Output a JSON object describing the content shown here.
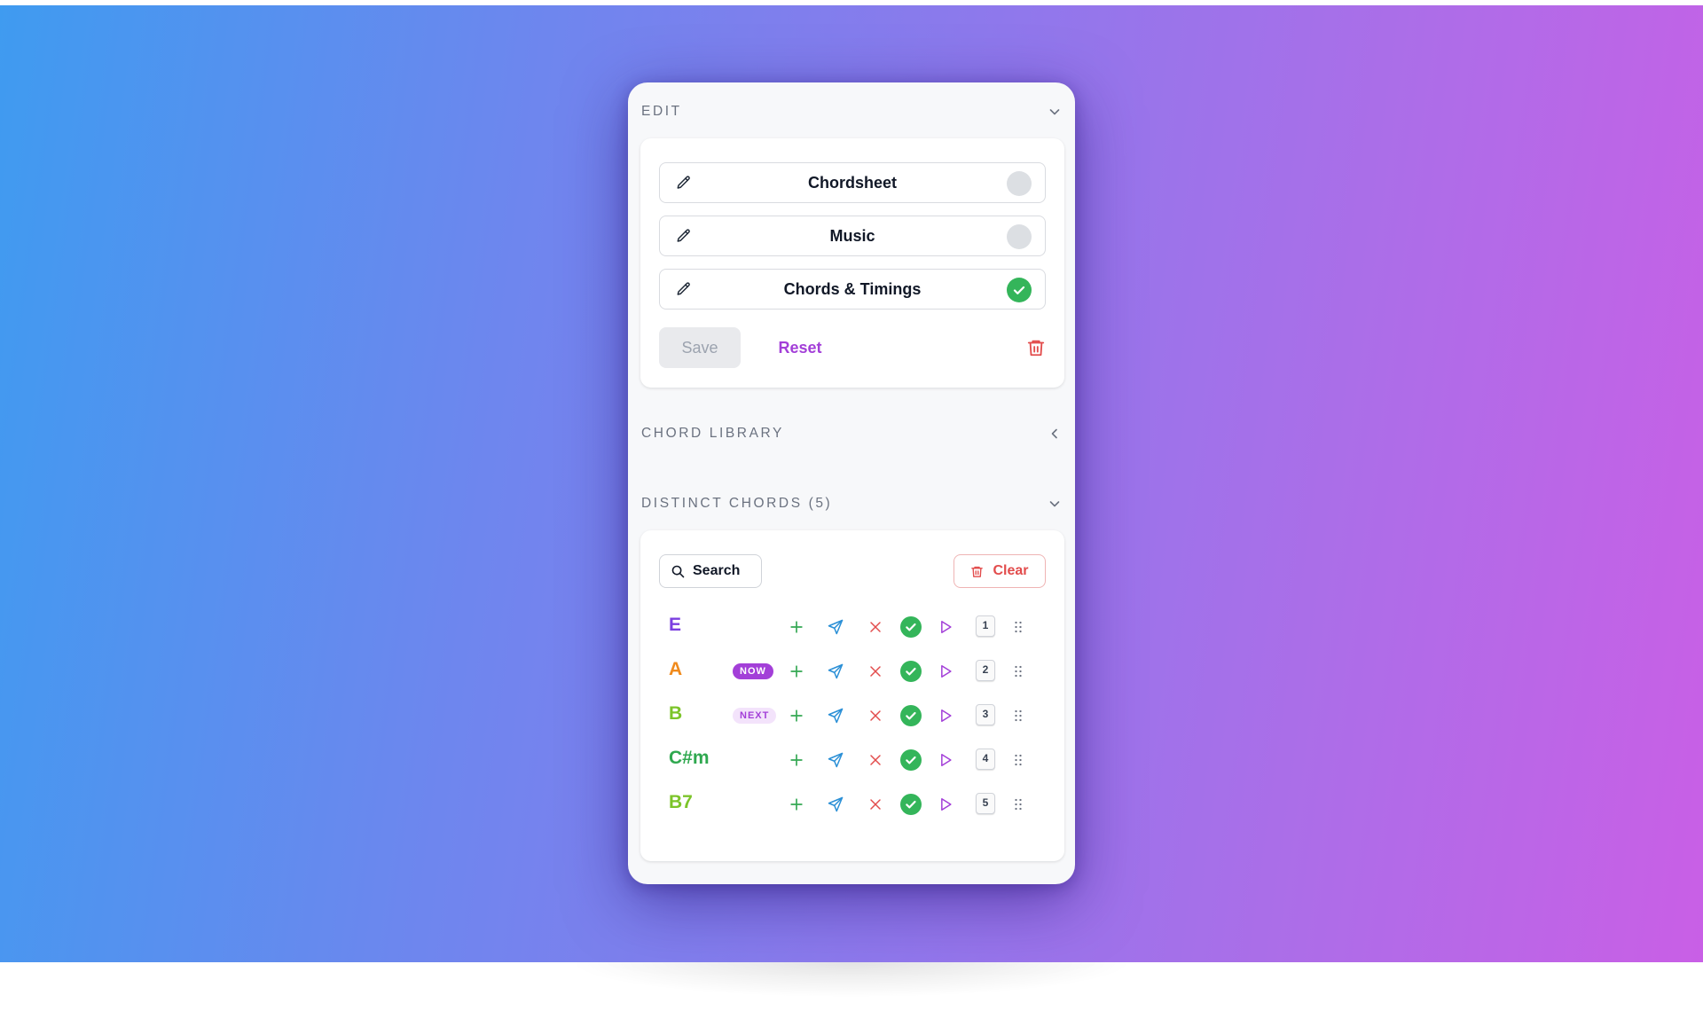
{
  "edit": {
    "title": "EDIT",
    "modes": [
      {
        "label": "Chordsheet",
        "active": false
      },
      {
        "label": "Music",
        "active": false
      },
      {
        "label": "Chords & Timings",
        "active": true
      }
    ],
    "save_label": "Save",
    "reset_label": "Reset"
  },
  "chord_library": {
    "title": "CHORD LIBRARY"
  },
  "distinct": {
    "title": "DISTINCT CHORDS (5)",
    "search_label": "Search",
    "clear_label": "Clear",
    "chords": [
      {
        "name": "E",
        "color": "#7b3fe0",
        "badge": "",
        "order": "1"
      },
      {
        "name": "A",
        "color": "#f08a1c",
        "badge": "NOW",
        "order": "2"
      },
      {
        "name": "B",
        "color": "#7cc42a",
        "badge": "NEXT",
        "order": "3"
      },
      {
        "name": "C#m",
        "color": "#2fa84f",
        "badge": "",
        "order": "4"
      },
      {
        "name": "B7",
        "color": "#7cc42a",
        "badge": "",
        "order": "5"
      }
    ]
  },
  "colors": {
    "accent": "#a33fd8",
    "danger": "#e24c4c",
    "success": "#34b55a",
    "info": "#2a8fd6"
  }
}
